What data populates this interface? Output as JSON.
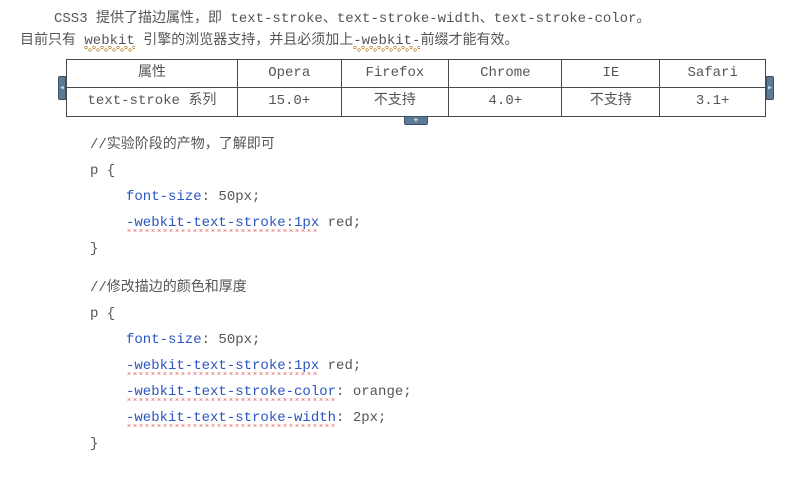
{
  "intro": {
    "line1_a": "CSS3 提供了描边属性，即 ",
    "line1_b": "text-stroke、text-stroke-width、text-stroke-color",
    "line1_c": "。",
    "line2_a": "目前只有 ",
    "line2_b": "webkit",
    "line2_c": " 引擎的浏览器支持，并且必须加上",
    "line2_d": "-webkit-",
    "line2_e": "前缀才能有效。"
  },
  "table": {
    "headers": [
      "属性",
      "Opera",
      "Firefox",
      "Chrome",
      "IE",
      "Safari"
    ],
    "row": [
      "text-stroke 系列",
      "15.0+",
      "不支持",
      "4.0+",
      "不支持",
      "3.1+"
    ]
  },
  "code1": {
    "comment": "//实验阶段的产物，了解即可",
    "sel": "p {",
    "l1_prop": "font-size",
    "l1_rest": ": 50px;",
    "l2_prop": "-webkit-text-stroke:1px",
    "l2_rest": " red;",
    "close": "}"
  },
  "code2": {
    "comment": "//修改描边的颜色和厚度",
    "sel": "p {",
    "l1_prop": "font-size",
    "l1_rest": ": 50px;",
    "l2_prop": "-webkit-text-stroke:1px",
    "l2_rest": " red;",
    "l3_prop": "-webkit-text-stroke-color",
    "l3_rest": ": orange;",
    "l4_prop": "-webkit-text-stroke-width",
    "l4_rest": ": 2px;",
    "close": "}"
  }
}
